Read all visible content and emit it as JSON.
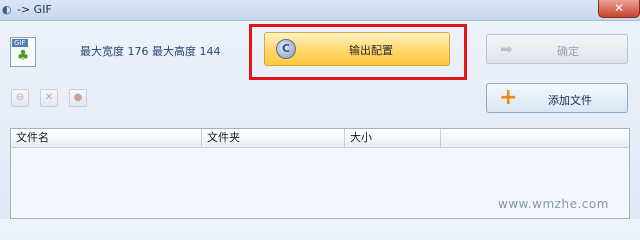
{
  "window": {
    "title": "-> GIF",
    "close_label": "✕"
  },
  "info": {
    "dimensions": "最大宽度 176 最大高度 144"
  },
  "buttons": {
    "output_config": "输出配置",
    "ok": "确定",
    "add_file": "添加文件"
  },
  "file_icon": {
    "tag": "GIF"
  },
  "table": {
    "columns": [
      "文件名",
      "文件夹",
      "大小"
    ]
  },
  "watermark": "www.wmzhe.com",
  "colors": {
    "highlight_border": "#e0161a",
    "output_button": "#ffd76a",
    "add_icon": "#f08a16"
  }
}
